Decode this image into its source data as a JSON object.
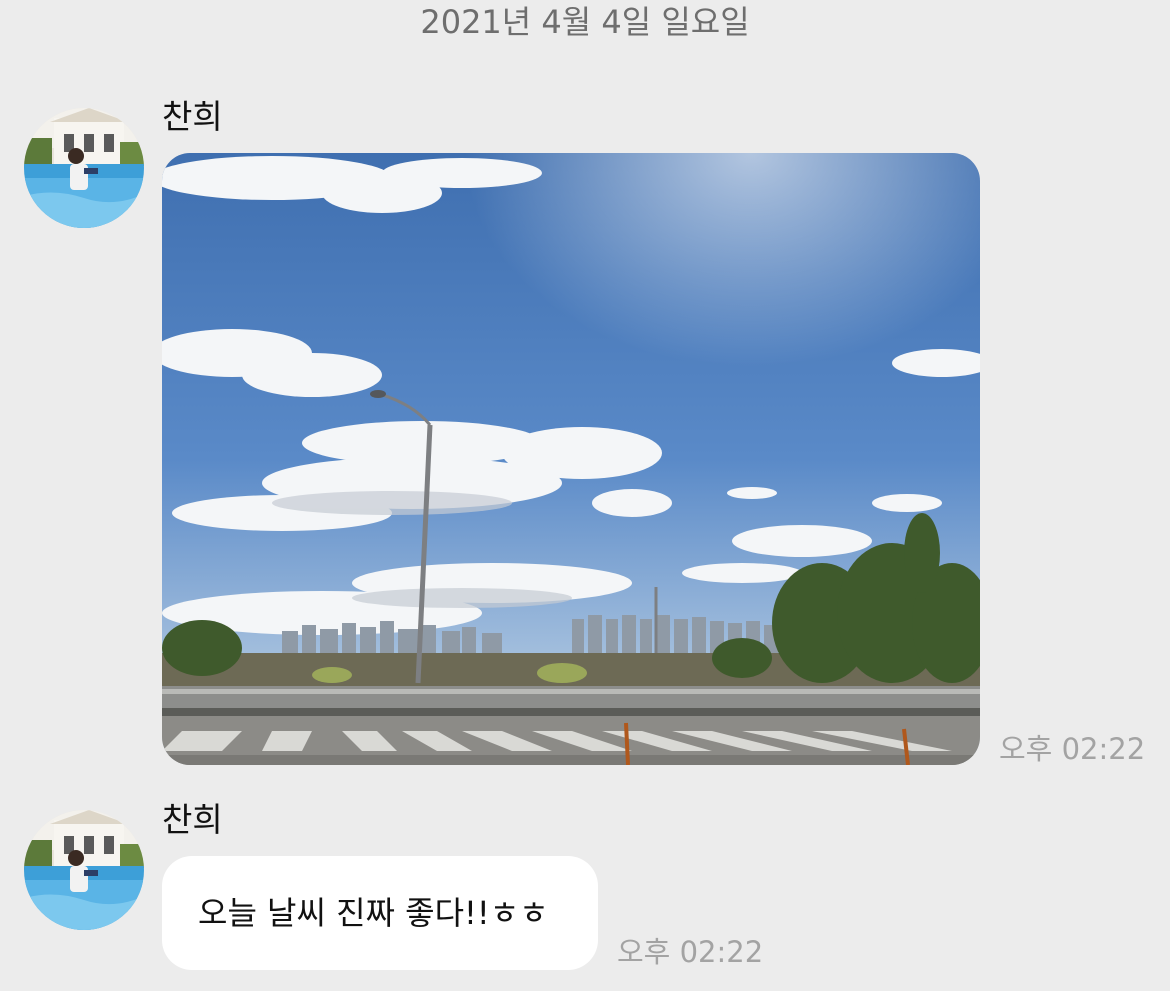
{
  "date_separator": "2021년 4월 4일 일요일",
  "messages": [
    {
      "sender": "찬희",
      "type": "photo",
      "time": "오후 02:22"
    },
    {
      "sender": "찬희",
      "type": "text",
      "text": "오늘 날씨 진짜 좋다!!ㅎㅎ",
      "time": "오후 02:22"
    }
  ],
  "colors": {
    "background": "#ececec",
    "bubble": "#ffffff",
    "timestamp": "#a3a3a3",
    "date_text": "#6e6e6e"
  }
}
